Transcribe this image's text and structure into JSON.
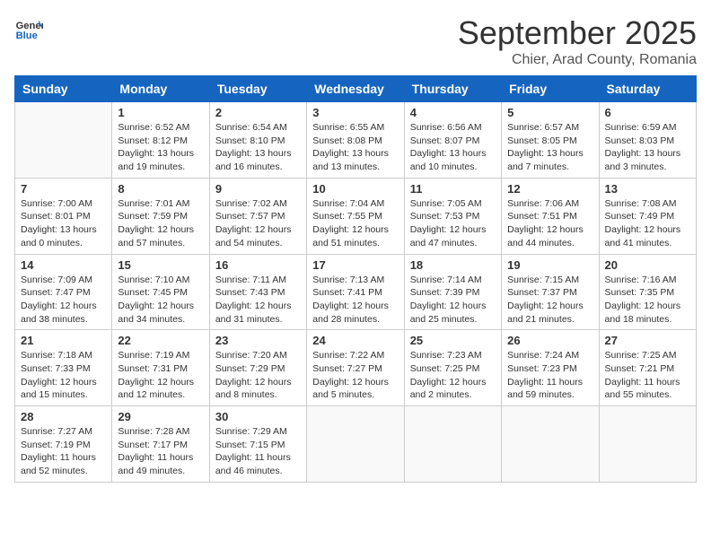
{
  "header": {
    "logo_general": "General",
    "logo_blue": "Blue",
    "month_title": "September 2025",
    "location": "Chier, Arad County, Romania"
  },
  "days_of_week": [
    "Sunday",
    "Monday",
    "Tuesday",
    "Wednesday",
    "Thursday",
    "Friday",
    "Saturday"
  ],
  "weeks": [
    [
      {
        "num": "",
        "sunrise": "",
        "sunset": "",
        "daylight": "",
        "empty": true
      },
      {
        "num": "1",
        "sunrise": "Sunrise: 6:52 AM",
        "sunset": "Sunset: 8:12 PM",
        "daylight": "Daylight: 13 hours and 19 minutes."
      },
      {
        "num": "2",
        "sunrise": "Sunrise: 6:54 AM",
        "sunset": "Sunset: 8:10 PM",
        "daylight": "Daylight: 13 hours and 16 minutes."
      },
      {
        "num": "3",
        "sunrise": "Sunrise: 6:55 AM",
        "sunset": "Sunset: 8:08 PM",
        "daylight": "Daylight: 13 hours and 13 minutes."
      },
      {
        "num": "4",
        "sunrise": "Sunrise: 6:56 AM",
        "sunset": "Sunset: 8:07 PM",
        "daylight": "Daylight: 13 hours and 10 minutes."
      },
      {
        "num": "5",
        "sunrise": "Sunrise: 6:57 AM",
        "sunset": "Sunset: 8:05 PM",
        "daylight": "Daylight: 13 hours and 7 minutes."
      },
      {
        "num": "6",
        "sunrise": "Sunrise: 6:59 AM",
        "sunset": "Sunset: 8:03 PM",
        "daylight": "Daylight: 13 hours and 3 minutes."
      }
    ],
    [
      {
        "num": "7",
        "sunrise": "Sunrise: 7:00 AM",
        "sunset": "Sunset: 8:01 PM",
        "daylight": "Daylight: 13 hours and 0 minutes."
      },
      {
        "num": "8",
        "sunrise": "Sunrise: 7:01 AM",
        "sunset": "Sunset: 7:59 PM",
        "daylight": "Daylight: 12 hours and 57 minutes."
      },
      {
        "num": "9",
        "sunrise": "Sunrise: 7:02 AM",
        "sunset": "Sunset: 7:57 PM",
        "daylight": "Daylight: 12 hours and 54 minutes."
      },
      {
        "num": "10",
        "sunrise": "Sunrise: 7:04 AM",
        "sunset": "Sunset: 7:55 PM",
        "daylight": "Daylight: 12 hours and 51 minutes."
      },
      {
        "num": "11",
        "sunrise": "Sunrise: 7:05 AM",
        "sunset": "Sunset: 7:53 PM",
        "daylight": "Daylight: 12 hours and 47 minutes."
      },
      {
        "num": "12",
        "sunrise": "Sunrise: 7:06 AM",
        "sunset": "Sunset: 7:51 PM",
        "daylight": "Daylight: 12 hours and 44 minutes."
      },
      {
        "num": "13",
        "sunrise": "Sunrise: 7:08 AM",
        "sunset": "Sunset: 7:49 PM",
        "daylight": "Daylight: 12 hours and 41 minutes."
      }
    ],
    [
      {
        "num": "14",
        "sunrise": "Sunrise: 7:09 AM",
        "sunset": "Sunset: 7:47 PM",
        "daylight": "Daylight: 12 hours and 38 minutes."
      },
      {
        "num": "15",
        "sunrise": "Sunrise: 7:10 AM",
        "sunset": "Sunset: 7:45 PM",
        "daylight": "Daylight: 12 hours and 34 minutes."
      },
      {
        "num": "16",
        "sunrise": "Sunrise: 7:11 AM",
        "sunset": "Sunset: 7:43 PM",
        "daylight": "Daylight: 12 hours and 31 minutes."
      },
      {
        "num": "17",
        "sunrise": "Sunrise: 7:13 AM",
        "sunset": "Sunset: 7:41 PM",
        "daylight": "Daylight: 12 hours and 28 minutes."
      },
      {
        "num": "18",
        "sunrise": "Sunrise: 7:14 AM",
        "sunset": "Sunset: 7:39 PM",
        "daylight": "Daylight: 12 hours and 25 minutes."
      },
      {
        "num": "19",
        "sunrise": "Sunrise: 7:15 AM",
        "sunset": "Sunset: 7:37 PM",
        "daylight": "Daylight: 12 hours and 21 minutes."
      },
      {
        "num": "20",
        "sunrise": "Sunrise: 7:16 AM",
        "sunset": "Sunset: 7:35 PM",
        "daylight": "Daylight: 12 hours and 18 minutes."
      }
    ],
    [
      {
        "num": "21",
        "sunrise": "Sunrise: 7:18 AM",
        "sunset": "Sunset: 7:33 PM",
        "daylight": "Daylight: 12 hours and 15 minutes."
      },
      {
        "num": "22",
        "sunrise": "Sunrise: 7:19 AM",
        "sunset": "Sunset: 7:31 PM",
        "daylight": "Daylight: 12 hours and 12 minutes."
      },
      {
        "num": "23",
        "sunrise": "Sunrise: 7:20 AM",
        "sunset": "Sunset: 7:29 PM",
        "daylight": "Daylight: 12 hours and 8 minutes."
      },
      {
        "num": "24",
        "sunrise": "Sunrise: 7:22 AM",
        "sunset": "Sunset: 7:27 PM",
        "daylight": "Daylight: 12 hours and 5 minutes."
      },
      {
        "num": "25",
        "sunrise": "Sunrise: 7:23 AM",
        "sunset": "Sunset: 7:25 PM",
        "daylight": "Daylight: 12 hours and 2 minutes."
      },
      {
        "num": "26",
        "sunrise": "Sunrise: 7:24 AM",
        "sunset": "Sunset: 7:23 PM",
        "daylight": "Daylight: 11 hours and 59 minutes."
      },
      {
        "num": "27",
        "sunrise": "Sunrise: 7:25 AM",
        "sunset": "Sunset: 7:21 PM",
        "daylight": "Daylight: 11 hours and 55 minutes."
      }
    ],
    [
      {
        "num": "28",
        "sunrise": "Sunrise: 7:27 AM",
        "sunset": "Sunset: 7:19 PM",
        "daylight": "Daylight: 11 hours and 52 minutes."
      },
      {
        "num": "29",
        "sunrise": "Sunrise: 7:28 AM",
        "sunset": "Sunset: 7:17 PM",
        "daylight": "Daylight: 11 hours and 49 minutes."
      },
      {
        "num": "30",
        "sunrise": "Sunrise: 7:29 AM",
        "sunset": "Sunset: 7:15 PM",
        "daylight": "Daylight: 11 hours and 46 minutes."
      },
      {
        "num": "",
        "sunrise": "",
        "sunset": "",
        "daylight": "",
        "empty": true
      },
      {
        "num": "",
        "sunrise": "",
        "sunset": "",
        "daylight": "",
        "empty": true
      },
      {
        "num": "",
        "sunrise": "",
        "sunset": "",
        "daylight": "",
        "empty": true
      },
      {
        "num": "",
        "sunrise": "",
        "sunset": "",
        "daylight": "",
        "empty": true
      }
    ]
  ]
}
